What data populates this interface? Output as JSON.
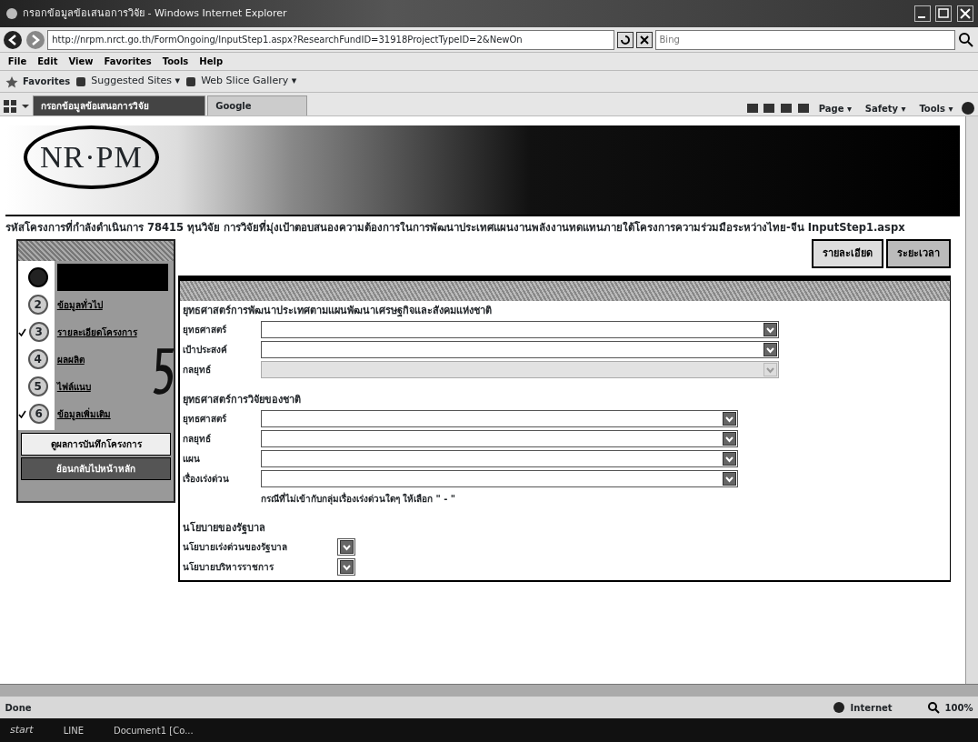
{
  "window": {
    "title": "กรอกข้อมูลข้อเสนอการวิจัย - Windows Internet Explorer"
  },
  "address": {
    "url": "http://nrpm.nrct.go.th/FormOngoing/InputStep1.aspx?ResearchFundID=31918ProjectTypeID=2&NewOn"
  },
  "search": {
    "placeholder": "Bing"
  },
  "menu": [
    "File",
    "Edit",
    "View",
    "Favorites",
    "Tools",
    "Help"
  ],
  "favorites_bar": {
    "label": "Favorites",
    "links": [
      "Suggested Sites ▾",
      "Web Slice Gallery ▾"
    ]
  },
  "tabs": [
    {
      "label": "กรอกข้อมูลข้อเสนอการวิจัย",
      "selected": true
    },
    {
      "label": "Google",
      "selected": false
    }
  ],
  "command_bar": [
    "Page ▾",
    "Safety ▾",
    "Tools ▾"
  ],
  "page": {
    "logo": "NR·PM",
    "project_line": "รหัสโครงการที่กำลังดำเนินการ 78415 ทุนวิจัย การวิจัยที่มุ่งเป้าตอบสนองความต้องการในการพัฒนาประเทศแผนงานพลังงานทดแทนภายใต้โครงการความร่วมมือระหว่างไทย-จีน InputStep1.aspx",
    "view_tabs": [
      {
        "label": "รายละเอียด",
        "selected": true
      },
      {
        "label": "ระยะเวลา",
        "selected": false
      }
    ],
    "steps": [
      {
        "selected": true,
        "checked": false
      },
      {
        "number": "2",
        "label": "ข้อมูลทั่วไป",
        "selected": false,
        "checked": false
      },
      {
        "number": "3",
        "label": "รายละเอียดโครงการ",
        "selected": false,
        "checked": true
      },
      {
        "number": "4",
        "label": "ผลผลิต",
        "selected": false,
        "checked": false
      },
      {
        "number": "5",
        "label": "ไฟล์แนบ",
        "selected": false,
        "checked": false
      },
      {
        "number": "6",
        "label": "ข้อมูลเพิ่มเติม",
        "selected": false,
        "checked": true
      }
    ],
    "buttons": [
      {
        "label": "ดูผลการบันทึกโครงการ",
        "kind": "light"
      },
      {
        "label": "ย้อนกลับไปหน้าหลัก",
        "kind": "dark"
      }
    ],
    "form": {
      "sections": [
        {
          "heading": "ยุทธศาสตร์การพัฒนาประเทศตามแผนพัฒนาเศรษฐกิจและสังคมแห่งชาติ",
          "kind": "wide",
          "fields": [
            {
              "label": "ยุทธศาสตร์",
              "disabled": false
            },
            {
              "label": "เป้าประสงค์",
              "disabled": false
            },
            {
              "label": "กลยุทธ์",
              "disabled": true
            }
          ]
        },
        {
          "heading": "ยุทธศาสตร์การวิจัยของชาติ",
          "kind": "medium",
          "fields": [
            {
              "label": "ยุทธศาสตร์",
              "disabled": false
            },
            {
              "label": "กลยุทธ์",
              "disabled": false
            },
            {
              "label": "แผน",
              "disabled": false
            },
            {
              "label": "เรื่องเร่งด่วน",
              "disabled": false
            }
          ],
          "note": "กรณีที่ไม่เข้ากับกลุ่มเรื่องเร่งด่วนใดๆ ให้เลือก \" - \""
        },
        {
          "heading": "นโยบายของรัฐบาล",
          "kind": "compact",
          "fields": [
            {
              "label": "นโยบายเร่งด่วนของรัฐบาล",
              "disabled": false
            },
            {
              "label": "นโยบายบริหารราชการ",
              "disabled": false
            }
          ]
        }
      ]
    }
  },
  "status_bar": {
    "text": "Done",
    "zone": "Internet",
    "zoom": "100%"
  },
  "taskbar": {
    "start": "start",
    "items": [
      "LINE",
      "Document1 [Co..."
    ]
  }
}
